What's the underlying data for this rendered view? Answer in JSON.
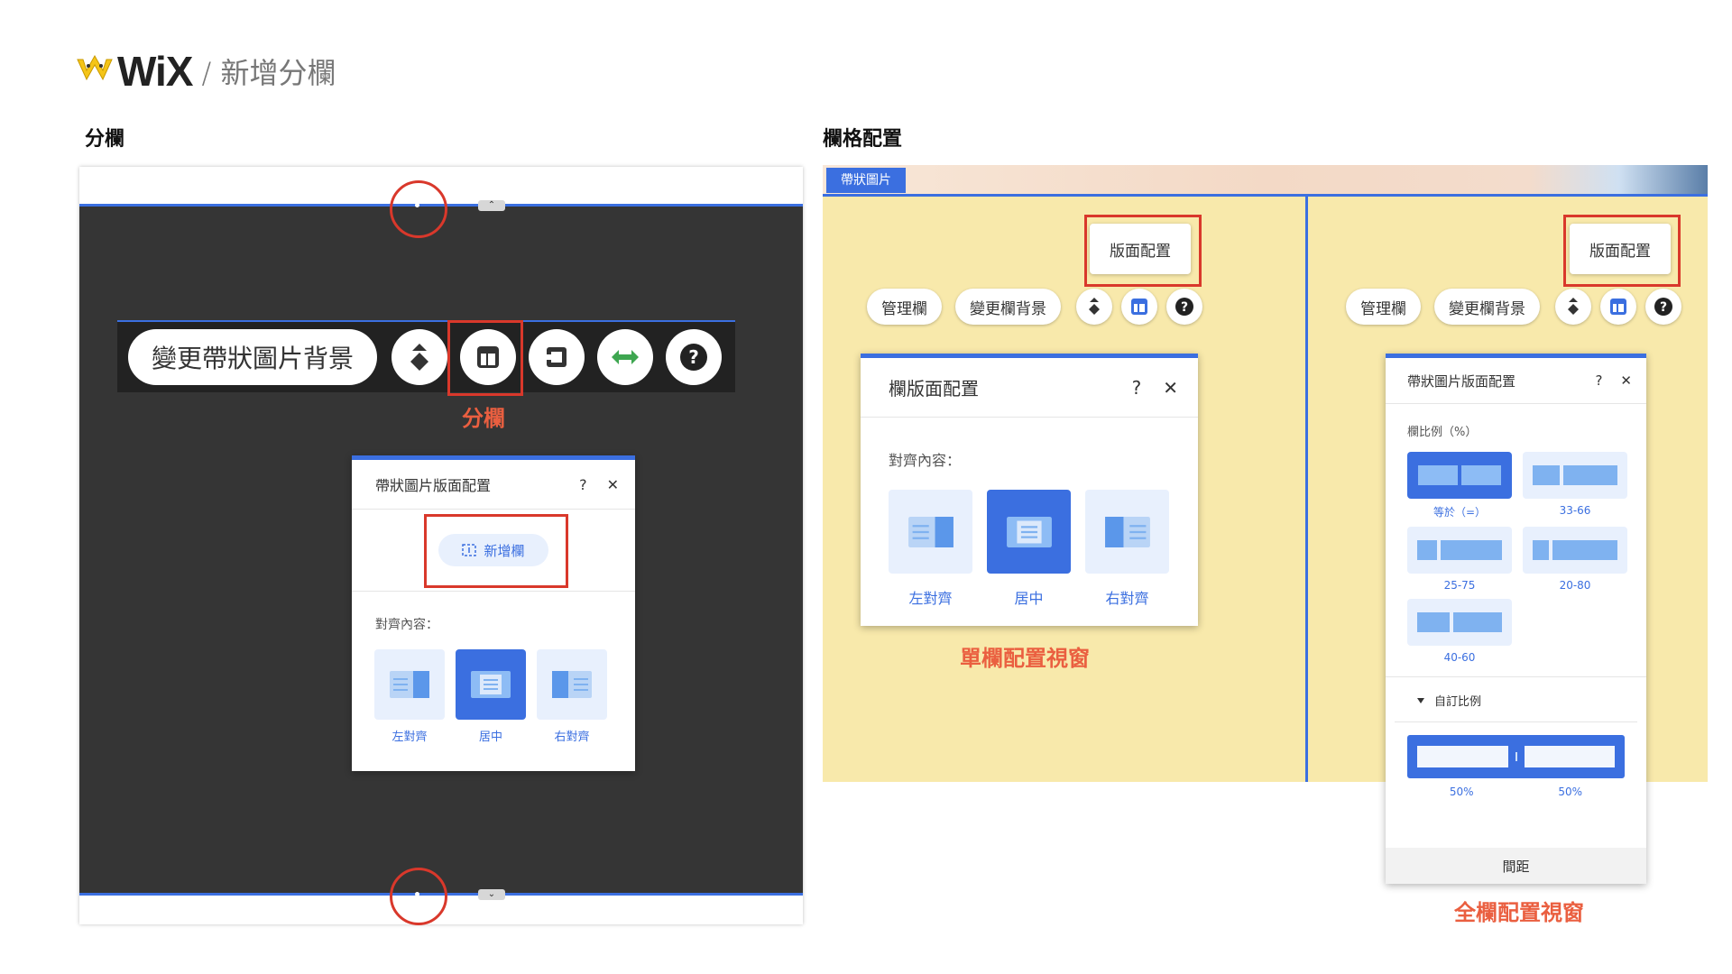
{
  "header": {
    "logo_text": "WiX",
    "subtitle": "/ 新增分欄"
  },
  "left": {
    "section_title": "分欄",
    "toolbar": {
      "change_bg_label": "變更帶狀圖片背景"
    },
    "annotation_label": "分欄",
    "dialog": {
      "title": "帶狀圖片版面配置",
      "help": "?",
      "close": "✕",
      "add_column_label": "新增欄",
      "align_title": "對齊內容：",
      "align_options": [
        "左對齊",
        "居中",
        "右對齊"
      ],
      "selected_index": 1
    }
  },
  "right": {
    "section_title": "欄格配置",
    "strip_tag": "帶狀圖片",
    "tooltip_label": "版面配置",
    "toolbar": {
      "manage_label": "管理欄",
      "change_bg_label": "變更欄背景"
    },
    "single_dialog": {
      "title": "欄版面配置",
      "help": "?",
      "close": "✕",
      "align_title": "對齊內容：",
      "align_options": [
        "左對齊",
        "居中",
        "右對齊"
      ],
      "selected_index": 1
    },
    "single_caption": "單欄配置視窗",
    "full_dialog": {
      "title": "帶狀圖片版面配置",
      "help": "?",
      "close": "✕",
      "ratio_title": "欄比例（%）",
      "ratio_options": [
        "等於（=）",
        "33-66",
        "25-75",
        "20-80",
        "40-60"
      ],
      "selected_index": 0,
      "custom_ratio_label": "自訂比例",
      "custom_values": [
        "50%",
        "50%"
      ],
      "spacing_label": "間距"
    },
    "full_caption": "全欄配置視窗"
  },
  "colors": {
    "accent": "#3b6fe0",
    "annotation": "#d9382b",
    "dark_bg": "#353535",
    "yellow_bg": "#f8e9ab"
  }
}
